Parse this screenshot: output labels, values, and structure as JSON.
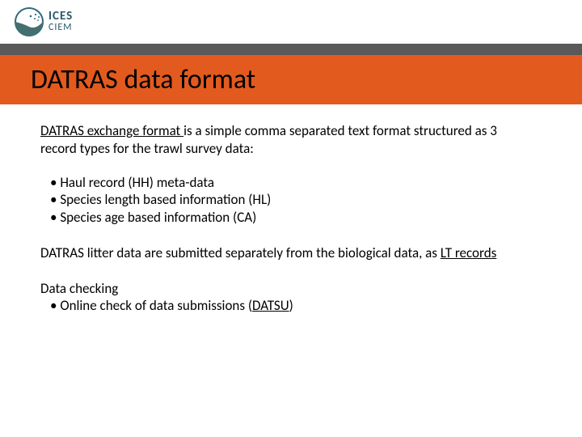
{
  "logo": {
    "line1": "ICES",
    "line2": "CIEM"
  },
  "title": "DATRAS data format",
  "intro": {
    "link": "DATRAS exchange format ",
    "rest": "is a simple comma separated text format structured as 3 record types for the trawl survey data:"
  },
  "records": [
    "Haul record (HH) meta-data",
    "Species length based information (HL)",
    "Species age based information (CA)"
  ],
  "litter": {
    "pre": "DATRAS litter data are submitted separately from the biological data, as ",
    "link": "LT records"
  },
  "check": {
    "heading": "Data checking",
    "item_pre": "Online check of data submissions (",
    "item_link": "DATSU",
    "item_post": ")"
  }
}
